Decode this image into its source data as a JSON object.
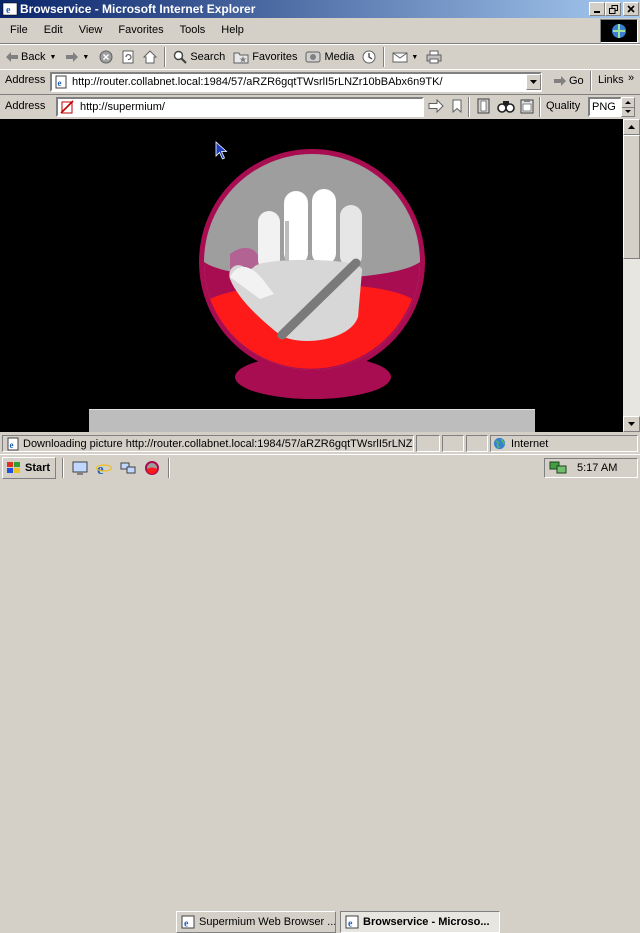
{
  "window": {
    "title": "Browservice - Microsoft Internet Explorer"
  },
  "menu": {
    "items": [
      "File",
      "Edit",
      "View",
      "Favorites",
      "Tools",
      "Help"
    ]
  },
  "toolbar": {
    "back": "Back",
    "search": "Search",
    "favorites": "Favorites",
    "media": "Media"
  },
  "ie_address": {
    "label": "Address",
    "url": "http://router.collabnet.local:1984/57/aRZR6gqtTWsrlI5rLNZr10bBAbx6n9TK/",
    "go": "Go",
    "links": "Links"
  },
  "browservice_bar": {
    "label": "Address",
    "url": "http://supermium/",
    "quality_label": "Quality",
    "quality_value": "PNG"
  },
  "status": {
    "text": "Downloading picture http://router.collabnet.local:1984/57/aRZR6gqtTWsrlI5rLNZr",
    "zone": "Internet"
  },
  "taskbar": {
    "start": "Start",
    "tasks": [
      "Supermium Web Browser ...",
      "Browservice - Microso..."
    ],
    "clock": "5:17 AM"
  },
  "colors": {
    "title_start": "#0a246a",
    "title_end": "#a6caf0",
    "face": "#d4d0c8",
    "logo_outer": "#a80d52",
    "logo_red": "#ff1a1a",
    "logo_gray": "#9e9e9e"
  }
}
